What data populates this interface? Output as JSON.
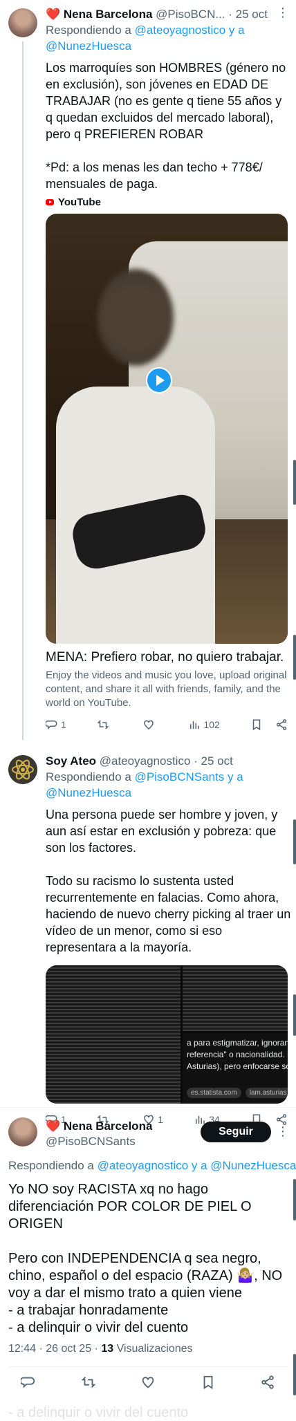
{
  "tweet1": {
    "display_name": "Nena Barcelona",
    "handle": "@PisoBCN...",
    "dot": "·",
    "date": "25 oct",
    "replying_prefix": "Respondiendo a",
    "reply_to": "@ateoyagnostico y a @NunezHuesca",
    "text": "Los marroquíes son HOMBRES (género no en exclusión), son jóvenes en EDAD DE TRABAJAR (no es gente q tiene 55 años y q quedan excluidos del mercado laboral), pero q PREFIEREN ROBAR\n\n*Pd: a los menas les dan techo + 778€/ mensuales de paga.",
    "card_source": "YouTube",
    "card_title": "MENA: Prefiero robar, no quiero trabajar.",
    "card_desc": "Enjoy the videos and music you love, upload original content, and share it all with friends, family, and the world on YouTube.",
    "replies": "1",
    "retweets": "",
    "likes": "",
    "views": "102"
  },
  "tweet2": {
    "display_name": "Soy Ateo",
    "handle": "@ateoyagnostico",
    "dot": "·",
    "date": "25 oct",
    "replying_prefix": "Respondiendo a",
    "reply_to": "@PisoBCNSants y a @NunezHuesca",
    "text": "Una persona puede ser hombre y joven, y aun así estar en exclusión y pobreza: que son los factores.\n\nTodo su racismo lo sustenta usted recurrentemente en falacias. Como ahora, haciendo de nuevo cherry picking al traer un vídeo de un menor, como si eso representara a la mayoría.",
    "image_overlay_text": "a para estigmatizar, ignorando c\nreferencia\" o nacionalidad. Hay m\nAsturias), pero enfocarse solo e",
    "image_chip1": "es.statista.com",
    "image_chip2": "lam.asturias.es",
    "replies": "1",
    "retweets": "",
    "likes": "1",
    "views": "34"
  },
  "main": {
    "display_name": "Nena Barcelona",
    "handle": "@PisoBCNSants",
    "follow_label": "Seguir",
    "replying_prefix": "Respondiendo a",
    "reply_to": "@ateoyagnostico y a @NunezHuesca",
    "text": "Yo NO soy RACISTA xq no hago diferenciación POR COLOR DE PIEL O ORIGEN\n\nPero con INDEPENDENCIA q sea negro, chino, español o del espacio (RAZA) 🤷🏼‍♀️, NO voy a dar el mismo trato a quien viene\n- a trabajar honradamente\n- a delinquir o vivir del cuento",
    "time": "12:44 · 26 oct 25 ·",
    "views_count": "13",
    "views_label": "Visualizaciones",
    "ghost_text": "- a delinquir o vivir del cuento"
  },
  "colors": {
    "accent": "#1d9bf0",
    "secondary_text": "#536471",
    "heart": "#f4212e",
    "follow_bg": "#0f1419"
  },
  "icons": [
    "reply-icon",
    "retweet-icon",
    "like-icon",
    "views-icon",
    "bookmark-icon",
    "share-icon",
    "play-icon",
    "youtube-icon",
    "more-icon"
  ]
}
